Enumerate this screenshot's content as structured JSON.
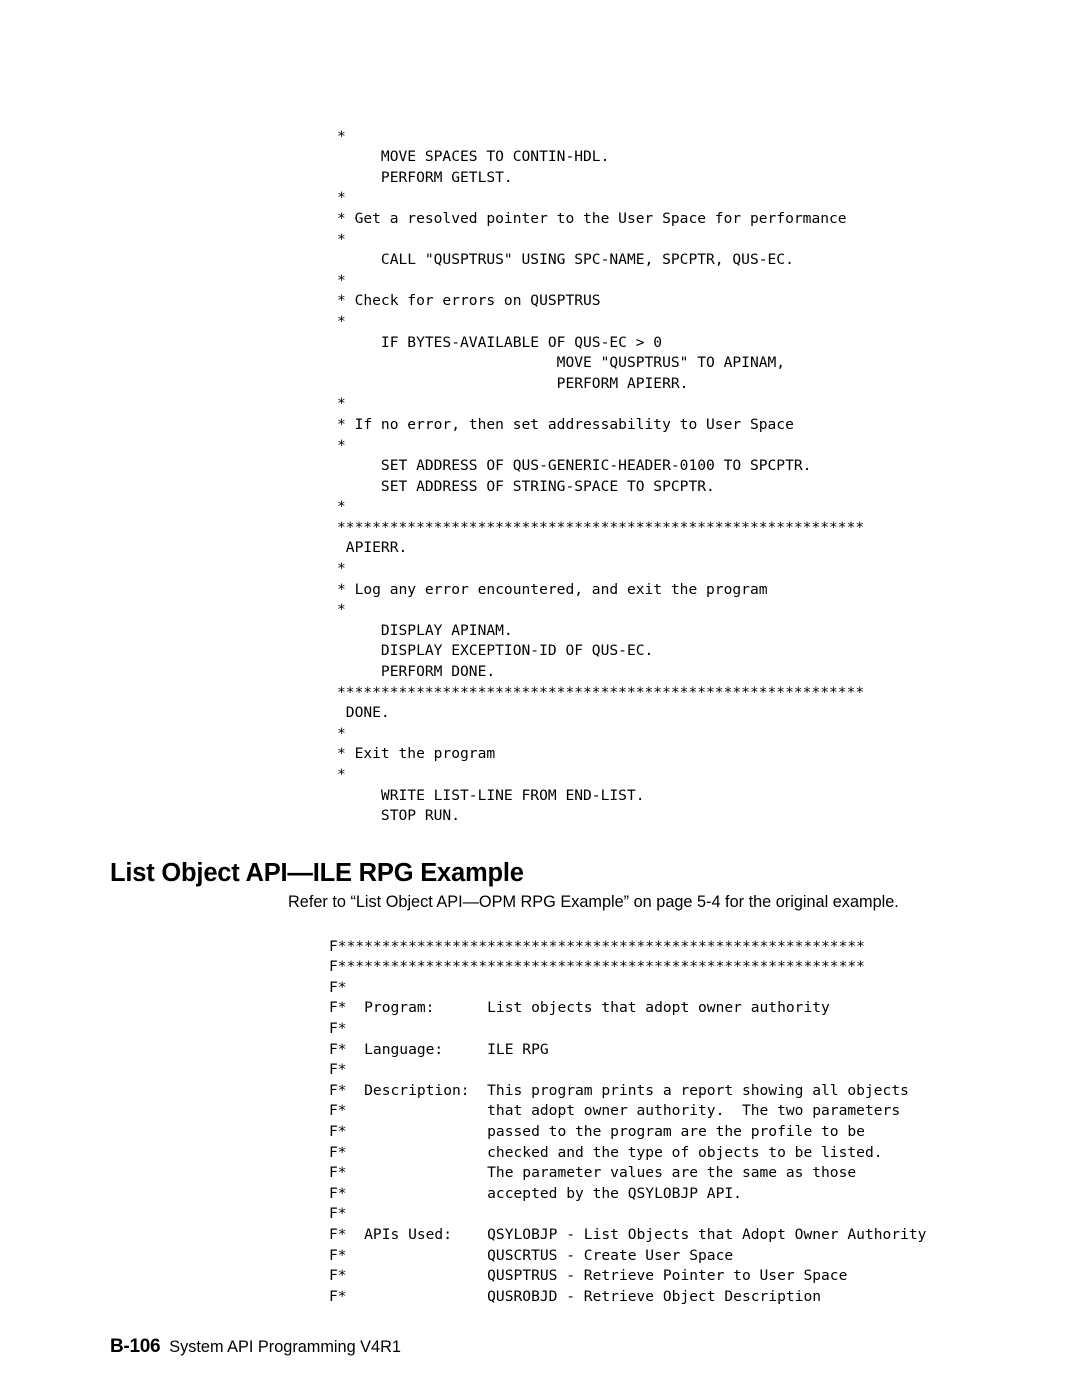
{
  "document": {
    "type": "technical-manual-page"
  },
  "cobol_code": {
    "name": "ile-cobol-example-continued",
    "lines": [
      "*",
      "     MOVE SPACES TO CONTIN-HDL.",
      "     PERFORM GETLST.",
      "*",
      "* Get a resolved pointer to the User Space for performance",
      "*",
      "     CALL \"QUSPTRUS\" USING SPC-NAME, SPCPTR, QUS-EC.",
      "*",
      "* Check for errors on QUSPTRUS",
      "*",
      "     IF BYTES-AVAILABLE OF QUS-EC > 0",
      "                         MOVE \"QUSPTRUS\" TO APINAM,",
      "                         PERFORM APIERR.",
      "*",
      "* If no error, then set addressability to User Space",
      "*",
      "     SET ADDRESS OF QUS-GENERIC-HEADER-0100 TO SPCPTR.",
      "     SET ADDRESS OF STRING-SPACE TO SPCPTR.",
      "*",
      "************************************************************",
      " APIERR.",
      "*",
      "* Log any error encountered, and exit the program",
      "*",
      "     DISPLAY APINAM.",
      "     DISPLAY EXCEPTION-ID OF QUS-EC.",
      "     PERFORM DONE.",
      "************************************************************",
      " DONE.",
      "*",
      "* Exit the program",
      "*",
      "     WRITE LIST-LINE FROM END-LIST.",
      "     STOP RUN."
    ]
  },
  "section": {
    "heading": "List Object API—ILE RPG Example",
    "intro": "Refer to “List Object API—OPM RPG Example” on page  5-4 for the original example."
  },
  "rpg_code": {
    "name": "ile-rpg-example-header",
    "lines": [
      "F************************************************************",
      "F************************************************************",
      "F*",
      "F*  Program:      List objects that adopt owner authority",
      "F*",
      "F*  Language:     ILE RPG",
      "F*",
      "F*  Description:  This program prints a report showing all objects",
      "F*                that adopt owner authority.  The two parameters",
      "F*                passed to the program are the profile to be",
      "F*                checked and the type of objects to be listed.",
      "F*                The parameter values are the same as those",
      "F*                accepted by the QSYLOBJP API.",
      "F*",
      "F*  APIs Used:    QSYLOBJP - List Objects that Adopt Owner Authority",
      "F*                QUSCRTUS - Create User Space",
      "F*                QUSPTRUS - Retrieve Pointer to User Space",
      "F*                QUSROBJD - Retrieve Object Description"
    ]
  },
  "footer": {
    "page_number": "B-106",
    "book_title": "System API Programming V4R1"
  }
}
